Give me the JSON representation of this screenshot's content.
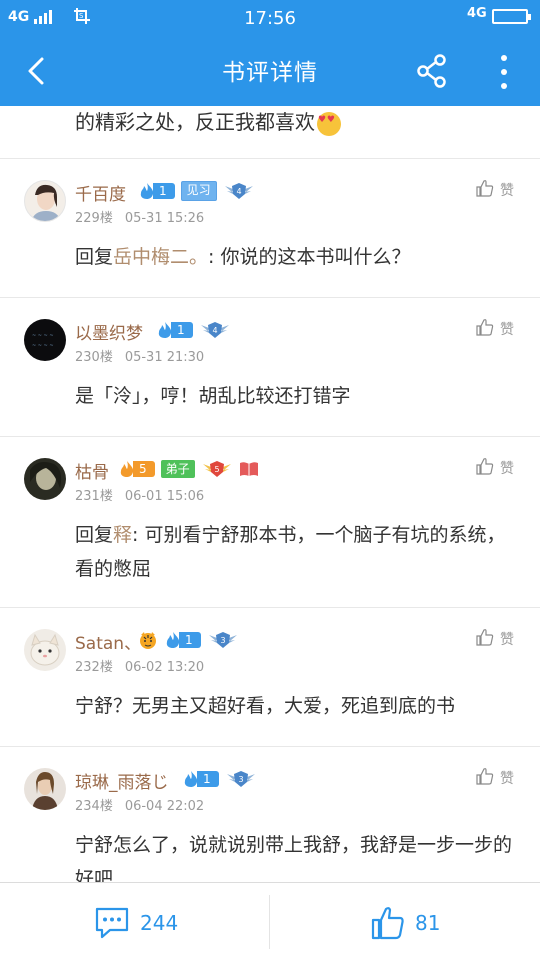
{
  "status": {
    "left_net": "4G",
    "time": "17:56",
    "right_net": "4G"
  },
  "nav": {
    "title": "书评详情"
  },
  "partial_text": "的精彩之处，反正我都喜欢",
  "comments": [
    {
      "name": "千百度",
      "level": "1",
      "tag": "见习",
      "wing_level": "4",
      "floor": "229楼",
      "time": "05-31 15:26",
      "like": "赞",
      "reply_prefix": "回复",
      "reply_to": "岳中梅二。",
      "text": ": 你说的这本书叫什么？"
    },
    {
      "name": "以墨织梦",
      "level": "1",
      "wing_level": "4",
      "floor": "230楼",
      "time": "05-31 21:30",
      "like": "赞",
      "text": "是「泠」，哼！胡乱比较还打错字"
    },
    {
      "name": "枯骨",
      "level": "5",
      "tag": "弟子",
      "wing_level": "5",
      "floor": "231楼",
      "time": "06-01 15:06",
      "like": "赞",
      "reply_prefix": "回复",
      "reply_to": "释",
      "text": ": 可别看宁舒那本书，一个脑子有坑的系统，看的憋屈"
    },
    {
      "name": "Satan、",
      "level": "1",
      "wing_level": "3",
      "floor": "232楼",
      "time": "06-02 13:20",
      "like": "赞",
      "text": "宁舒？无男主又超好看，大爱，死追到底的书"
    },
    {
      "name": "琼琳_雨落じ",
      "level": "1",
      "wing_level": "3",
      "floor": "234楼",
      "time": "06-04 22:02",
      "like": "赞",
      "text": "宁舒怎么了，说就说别带上我舒，我舒是一步一步的好吧"
    }
  ],
  "bottom": {
    "comment_count": "244",
    "like_count": "81"
  },
  "colors": {
    "primary": "#2b95e9",
    "name": "#9a6a4a",
    "meta": "#9a9a9a",
    "level_blue": "#3d9be9",
    "level_orange": "#f39a2b"
  }
}
